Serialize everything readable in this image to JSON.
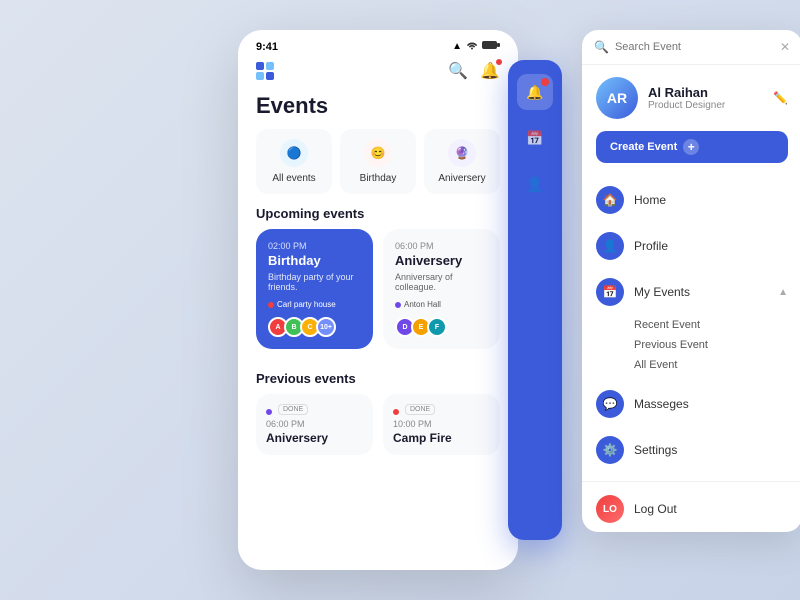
{
  "statusBar": {
    "time": "9:41",
    "signal": "▲▲▲",
    "wifi": "WiFi",
    "battery": "Battery"
  },
  "app": {
    "title": "Events"
  },
  "categories": [
    {
      "id": "all",
      "label": "All events",
      "iconColor": "cat-blue",
      "icon": "🔵"
    },
    {
      "id": "birthday",
      "label": "Birthday",
      "iconColor": "cat-red",
      "icon": "😊"
    },
    {
      "id": "anniversary",
      "label": "Aniversery",
      "iconColor": "cat-purple",
      "icon": "🔮"
    }
  ],
  "upcomingSection": "Upcoming events",
  "upcomingEvents": [
    {
      "time": "02:00 PM",
      "name": "Birthday",
      "desc": "Birthday party of your friends.",
      "location": "Carl party house",
      "type": "blue"
    },
    {
      "time": "06:00 PM",
      "name": "Aniversery",
      "desc": "Anniversary of colleague.",
      "location": "Anton Hall",
      "type": "white"
    }
  ],
  "previousSection": "Previous events",
  "previousEvents": [
    {
      "time": "06:00 PM",
      "name": "Aniversery",
      "dotColor": "#7048e8"
    },
    {
      "time": "10:00 PM",
      "name": "Camp Fire",
      "dotColor": "#f03e3e"
    }
  ],
  "sidebar": {
    "icons": [
      {
        "name": "notification-icon",
        "symbol": "🔔",
        "hasNotif": true
      },
      {
        "name": "calendar-icon",
        "symbol": "📅",
        "hasNotif": false
      },
      {
        "name": "user-icon",
        "symbol": "👤",
        "hasNotif": false
      }
    ]
  },
  "dropdown": {
    "search": {
      "placeholder": "Search Event"
    },
    "user": {
      "name": "Al Raihan",
      "role": "Product Designer",
      "initials": "AR"
    },
    "createButton": "Create Event",
    "navItems": [
      {
        "id": "home",
        "label": "Home",
        "icon": "🏠"
      },
      {
        "id": "profile",
        "label": "Profile",
        "icon": "👤"
      },
      {
        "id": "my-events",
        "label": "My Events",
        "icon": "📅",
        "expanded": true
      },
      {
        "id": "messages",
        "label": "Masseges",
        "icon": "💬"
      },
      {
        "id": "settings",
        "label": "Settings",
        "icon": "⚙️"
      }
    ],
    "subItems": [
      {
        "label": "Recent Event"
      },
      {
        "label": "Previous Event"
      },
      {
        "label": "All Event"
      }
    ],
    "logout": "Log Out"
  }
}
